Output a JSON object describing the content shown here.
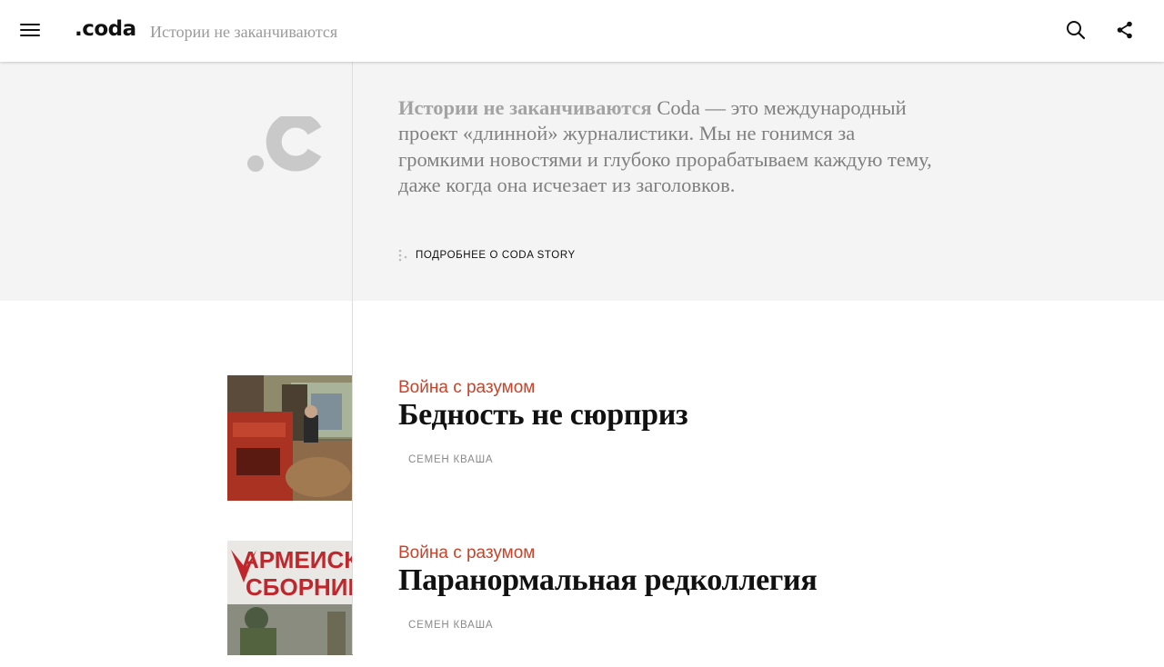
{
  "header": {
    "logo": ".coda",
    "tagline": "Истории не заканчиваются"
  },
  "intro": {
    "lead": "Истории не заканчиваются",
    "body": " Coda — это международный проект «длинной» журналистики. Мы не гонимся за громкими новостями и глубоко прорабатываем каждую тему, даже когда она исчезает из заголовков.",
    "more_link": "ПОДРОБНЕЕ О CODA STORY"
  },
  "articles": [
    {
      "category": "Война с разумом",
      "title": "Бедность не сюрприз",
      "author": "СЕМЕН КВАША"
    },
    {
      "category": "Война с разумом",
      "title": "Паранормальная редколлегия",
      "author": "СЕМЕН КВАША",
      "image_text": [
        "АРМЕИСК",
        "СБОРНИК"
      ]
    }
  ],
  "icons": {
    "menu": "menu-icon",
    "search": "search-icon",
    "share": "share-icon",
    "more": "dots-icon"
  },
  "colors": {
    "accent": "#c8432a",
    "intro_bg": "#f4f4f4",
    "tagline": "#9a9a9a"
  }
}
